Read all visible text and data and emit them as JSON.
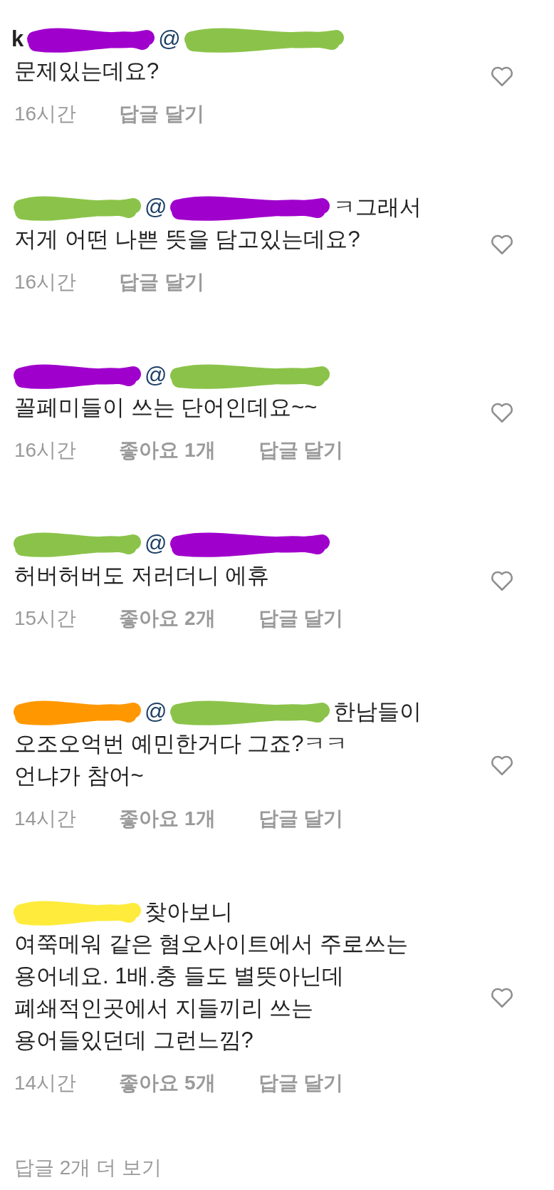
{
  "comments": [
    {
      "header": [
        {
          "kind": "username",
          "text": "k"
        },
        {
          "kind": "redaction",
          "color": "#a000cc"
        },
        {
          "kind": "mention",
          "text": "@"
        },
        {
          "kind": "redaction",
          "color": "#8bc34a"
        }
      ],
      "lines": [
        "문제있는데요?"
      ],
      "time": "16시간",
      "reply": "답글 달기"
    },
    {
      "header": [
        {
          "kind": "redaction",
          "color": "#8bc34a"
        },
        {
          "kind": "mention",
          "text": "@"
        },
        {
          "kind": "redaction",
          "color": "#a000cc"
        },
        {
          "kind": "text",
          "text": "ㅋ그래서"
        }
      ],
      "lines": [
        "저게 어떤 나쁜 뜻을 담고있는데요?"
      ],
      "time": "16시간",
      "reply": "답글 달기"
    },
    {
      "header": [
        {
          "kind": "redaction",
          "color": "#a000cc"
        },
        {
          "kind": "mention",
          "text": "@"
        },
        {
          "kind": "redaction",
          "color": "#8bc34a"
        }
      ],
      "lines": [
        "꼴페미들이 쓰는 단어인데요~~"
      ],
      "time": "16시간",
      "likes": "좋아요 1개",
      "reply": "답글 달기"
    },
    {
      "header": [
        {
          "kind": "redaction",
          "color": "#8bc34a"
        },
        {
          "kind": "mention",
          "text": "@"
        },
        {
          "kind": "redaction",
          "color": "#a000cc"
        }
      ],
      "lines": [
        "허버허버도 저러더니 에휴"
      ],
      "time": "15시간",
      "likes": "좋아요 2개",
      "reply": "답글 달기"
    },
    {
      "header": [
        {
          "kind": "redaction",
          "color": "#ff9800"
        },
        {
          "kind": "mention",
          "text": "@"
        },
        {
          "kind": "redaction",
          "color": "#8bc34a"
        },
        {
          "kind": "text",
          "text": "한남들이"
        }
      ],
      "lines": [
        "오조오억번 예민한거다 그죠?ㅋㅋ",
        "언냐가 참어~"
      ],
      "time": "14시간",
      "likes": "좋아요 1개",
      "reply": "답글 달기"
    },
    {
      "header": [
        {
          "kind": "redaction",
          "color": "#ffeb3b"
        },
        {
          "kind": "text",
          "text": "찾아보니"
        }
      ],
      "lines": [
        "여쭉메워 같은 혐오사이트에서 주로쓰는",
        "용어네요. 1배.충 들도 별뜻아닌데",
        "폐쇄적인곳에서 지들끼리 쓰는",
        "용어들있던데 그런느낌?"
      ],
      "time": "14시간",
      "likes": "좋아요 5개",
      "reply": "답글 달기"
    }
  ],
  "more_replies": "답글 2개 더 보기"
}
